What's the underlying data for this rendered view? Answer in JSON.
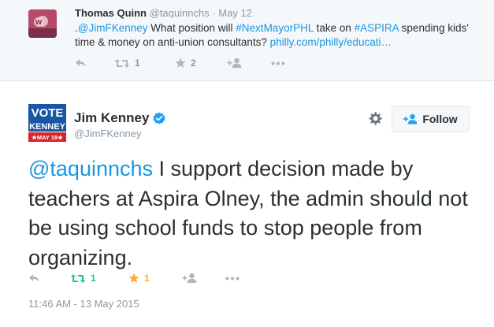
{
  "top_tweet": {
    "name": "Thomas Quinn",
    "handle": "@taquinnchs",
    "date": "May 12",
    "text_parts": [
      {
        "t": ".",
        "link": false
      },
      {
        "t": "@JimFKenney",
        "link": true
      },
      {
        "t": " What position will ",
        "link": false
      },
      {
        "t": "#NextMayorPHL",
        "link": true
      },
      {
        "t": " take on ",
        "link": false
      },
      {
        "t": "#ASPIRA",
        "link": true
      },
      {
        "t": " spending kids' time & money on anti-union consultants? ",
        "link": false
      },
      {
        "t": "philly.com/philly/educati…",
        "link": true
      }
    ],
    "retweet_count": "1",
    "favorite_count": "2"
  },
  "main_tweet": {
    "avatar": {
      "line1": "VOTE",
      "line2": "KENNEY",
      "line3": "★MAY 19★"
    },
    "name": "Jim Kenney",
    "handle": "@JimFKenney",
    "follow_label": "Follow",
    "text_mention": "@taquinnchs",
    "text_body": " I support decision made by teachers at Aspira Olney, the admin should not be using school funds to stop people from organizing.",
    "retweet_count": "1",
    "favorite_count": "1",
    "timestamp": "11:46 AM - 13 May 2015"
  },
  "colors": {
    "link": "#1b95e0",
    "retweet_active": "#19cf86",
    "favorite_active": "#ffac33",
    "icon_gray": "#aab8c2",
    "verified": "#1da1f2"
  },
  "icons": [
    "reply-icon",
    "retweet-icon",
    "favorite-icon",
    "follow-icon",
    "more-icon",
    "gear-icon",
    "verified-icon"
  ]
}
